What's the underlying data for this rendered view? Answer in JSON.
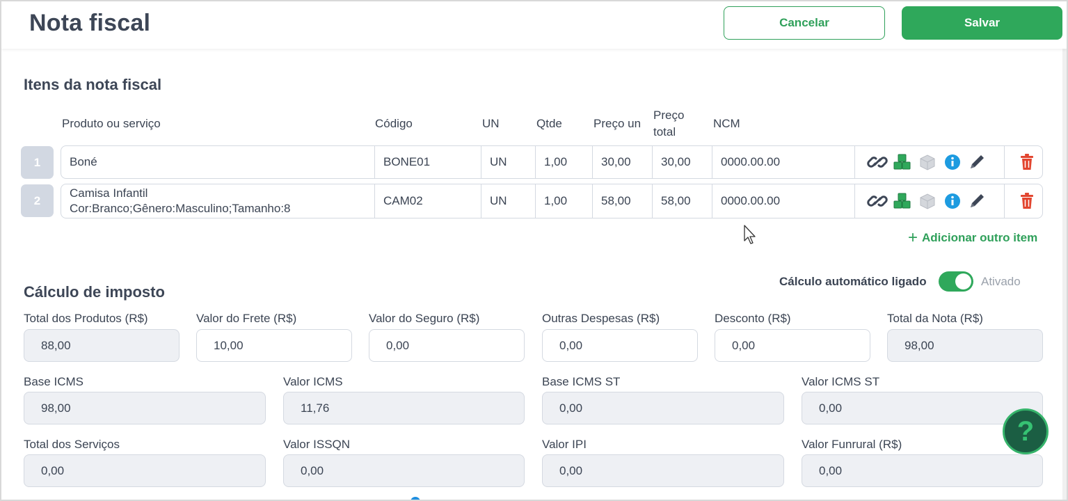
{
  "header": {
    "title": "Nota fiscal",
    "cancel_label": "Cancelar",
    "save_label": "Salvar"
  },
  "items_section": {
    "title": "Itens da nota fiscal",
    "columns": {
      "product": "Produto ou serviço",
      "code": "Código",
      "unit": "UN",
      "qty": "Qtde",
      "unit_price": "Preço un",
      "total_price_line1": "Preço",
      "total_price_line2": "total",
      "ncm": "NCM"
    },
    "rows": [
      {
        "num": "1",
        "product_line1": "Boné",
        "product_line2": "",
        "code": "BONE01",
        "unit": "UN",
        "qty": "1,00",
        "unit_price": "30,00",
        "total": "30,00",
        "ncm": "0000.00.00"
      },
      {
        "num": "2",
        "product_line1": "Camisa Infantil",
        "product_line2": "Cor:Branco;Gênero:Masculino;Tamanho:8",
        "code": "CAM02",
        "unit": "UN",
        "qty": "1,00",
        "unit_price": "58,00",
        "total": "58,00",
        "ncm": "0000.00.00"
      }
    ],
    "row_icons": [
      "link-icon",
      "boxes-icon",
      "box-icon",
      "info-icon",
      "pencil-icon",
      "trash-icon"
    ],
    "add_item_label": "Adicionar outro item"
  },
  "tax_section": {
    "title": "Cálculo de imposto",
    "auto_calc_label": "Cálculo automático ligado",
    "auto_calc_state": "Ativado",
    "auto_calc_on": true,
    "row1": [
      {
        "label": "Total dos Produtos (R$)",
        "value": "88,00",
        "readonly": true
      },
      {
        "label": "Valor do Frete (R$)",
        "value": "10,00",
        "readonly": false
      },
      {
        "label": "Valor do Seguro (R$)",
        "value": "0,00",
        "readonly": false
      },
      {
        "label": "Outras Despesas (R$)",
        "value": "0,00",
        "readonly": false
      },
      {
        "label": "Desconto (R$)",
        "value": "0,00",
        "readonly": false
      },
      {
        "label": "Total da Nota (R$)",
        "value": "98,00",
        "readonly": true
      }
    ],
    "row2": [
      {
        "label": "Base ICMS",
        "value": "98,00"
      },
      {
        "label": "Valor ICMS",
        "value": "11,76"
      },
      {
        "label": "Base ICMS ST",
        "value": "0,00"
      },
      {
        "label": "Valor ICMS ST",
        "value": "0,00"
      }
    ],
    "row3": [
      {
        "label": "Total dos Serviços",
        "value": "0,00"
      },
      {
        "label": "Valor ISSQN",
        "value": "0,00"
      },
      {
        "label": "Valor IPI",
        "value": "0,00"
      },
      {
        "label": "Valor Funrural (R$)",
        "value": "0,00"
      }
    ]
  },
  "help": {
    "label": "?"
  },
  "colors": {
    "accent": "#2fa85b",
    "title": "#3d4656",
    "danger": "#e2452f",
    "info": "#1d9be0",
    "help_bg": "#1b5e43"
  }
}
